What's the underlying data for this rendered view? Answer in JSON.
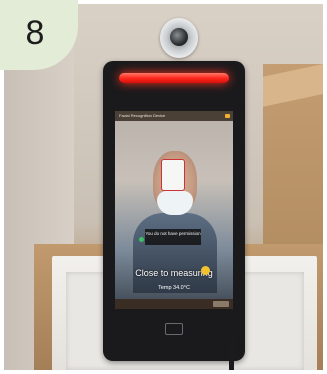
{
  "step_badge": {
    "number": "8"
  },
  "device_screen": {
    "header_text": "Facial Recognition Device",
    "permission_message": "You do not have permission",
    "instruction": "Close to measuring",
    "temperature": "Temp 34.0°C"
  },
  "colors": {
    "badge_bg": "#e3ecd6",
    "led_red": "#ff2a1e",
    "device_body": "#1a1a1c"
  }
}
